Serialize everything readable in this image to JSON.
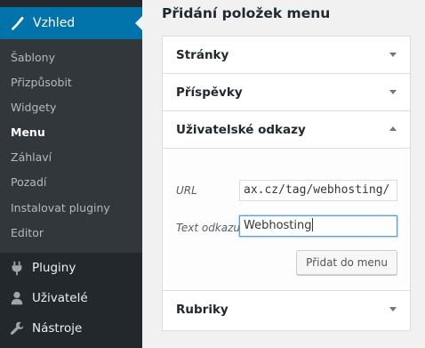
{
  "sidebar": {
    "active_menu": {
      "label": "Vzhled",
      "icon": "paintbrush-icon"
    },
    "submenu": [
      {
        "label": "Šablony"
      },
      {
        "label": "Přizpůsobit"
      },
      {
        "label": "Widgety"
      },
      {
        "label": "Menu",
        "current": true
      },
      {
        "label": "Záhlaví"
      },
      {
        "label": "Pozadí"
      },
      {
        "label": "Instalovat pluginy"
      },
      {
        "label": "Editor"
      }
    ],
    "menus": [
      {
        "label": "Pluginy",
        "icon": "plugin-icon"
      },
      {
        "label": "Uživatelé",
        "icon": "users-icon"
      },
      {
        "label": "Nástroje",
        "icon": "wrench-icon"
      }
    ]
  },
  "main": {
    "title": "Přidání položek menu",
    "sections": [
      {
        "title": "Stránky",
        "expanded": false
      },
      {
        "title": "Příspěvky",
        "expanded": false
      },
      {
        "title": "Uživatelské odkazy",
        "expanded": true
      },
      {
        "title": "Rubriky",
        "expanded": false
      }
    ],
    "custom_link": {
      "url_label": "URL",
      "url_value": "ax.cz/tag/webhosting/",
      "text_label": "Text odkazu",
      "text_value": "Webhosting",
      "add_button": "Přidat do menu"
    }
  },
  "colors": {
    "sidebar_bg": "#23282d",
    "submenu_bg": "#32373c",
    "accent": "#0073aa"
  }
}
